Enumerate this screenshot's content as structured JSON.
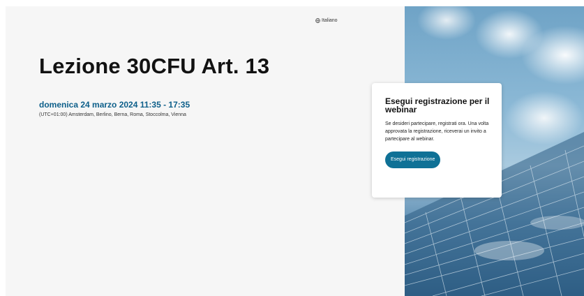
{
  "header": {
    "language_label": "Italiano",
    "language_icon": "globe-icon"
  },
  "event": {
    "title": "Lezione 30CFU Art. 13",
    "date_time": "domenica 24 marzo 2024 11:35 - 17:35",
    "timezone": "(UTC+01:00) Amsterdam, Berlino, Berna, Roma, Stoccolma, Vienna"
  },
  "registration_card": {
    "title": "Esegui registrazione per il webinar",
    "description": "Se desideri partecipare, registrati ora. Una volta approvata la registrazione, riceverai un invito a partecipare al webinar.",
    "button_label": "Esegui registrazione"
  },
  "colors": {
    "accent": "#0f7196",
    "date_text": "#0d5f8a",
    "page_background": "#f6f6f6"
  }
}
